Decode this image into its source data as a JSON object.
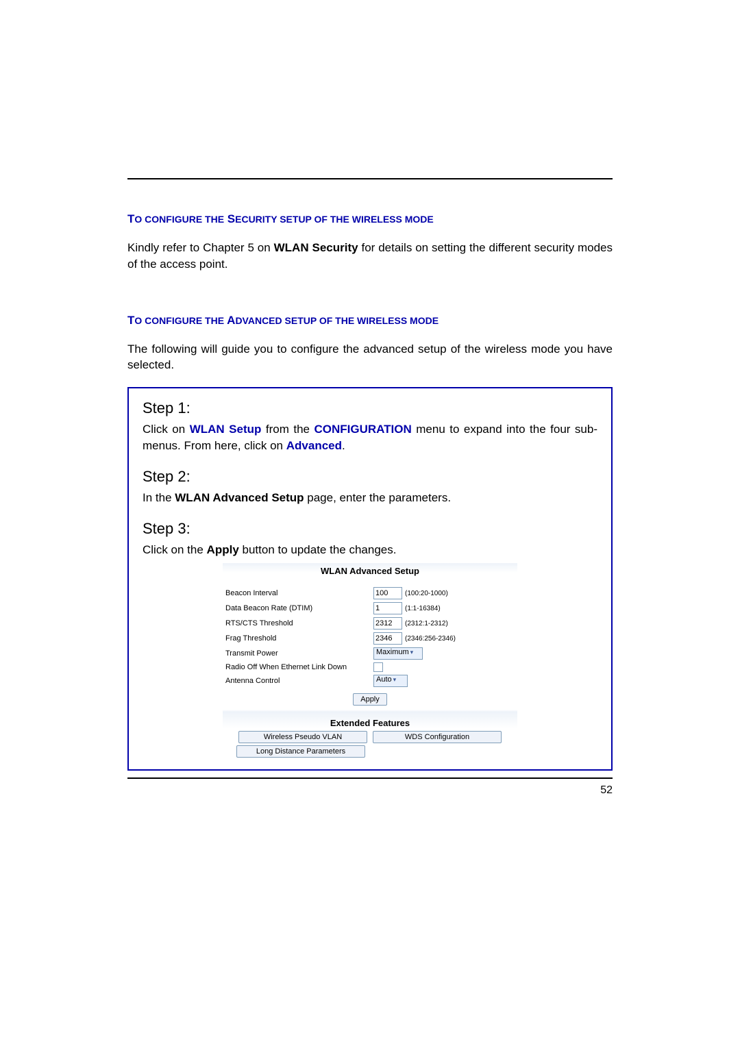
{
  "headings": {
    "security": "To configure the Security setup of the wireless mode",
    "advanced": "To configure the Advanced setup of the wireless mode"
  },
  "paragraphs": {
    "security_intro_a": "Kindly refer to Chapter 5 on ",
    "security_intro_bold": "WLAN Security",
    "security_intro_b": " for details on setting the different security modes of the access point.",
    "advanced_intro": "The following will guide you to configure the advanced setup of the wireless mode you have selected."
  },
  "steps": {
    "s1_title": "Step 1:",
    "s1_a": "Click on ",
    "s1_link1": "WLAN Setup",
    "s1_b": " from the ",
    "s1_link2": "CONFIGURATION",
    "s1_c": " menu to expand into the four sub-menus. From here, click on ",
    "s1_link3": "Advanced",
    "s1_d": ".",
    "s2_title": "Step 2:",
    "s2_a": "In the ",
    "s2_bold": "WLAN Advanced Setup",
    "s2_b": " page, enter the parameters.",
    "s3_title": "Step 3:",
    "s3_a": "Click on the ",
    "s3_bold": "Apply",
    "s3_b": " button to update the changes."
  },
  "form": {
    "title": "WLAN Advanced Setup",
    "rows": {
      "beacon": {
        "label": "Beacon Interval",
        "value": "100",
        "hint": "(100:20-1000)"
      },
      "dtim": {
        "label": "Data Beacon Rate (DTIM)",
        "value": "1",
        "hint": "(1:1-16384)"
      },
      "rts": {
        "label": "RTS/CTS Threshold",
        "value": "2312",
        "hint": "(2312:1-2312)"
      },
      "frag": {
        "label": "Frag Threshold",
        "value": "2346",
        "hint": "(2346:256-2346)"
      },
      "tx": {
        "label": "Transmit Power",
        "value": "Maximum"
      },
      "radio": {
        "label": "Radio Off When Ethernet Link Down"
      },
      "ant": {
        "label": "Antenna Control",
        "value": "Auto"
      }
    },
    "apply": "Apply",
    "ext_title": "Extended Features",
    "ext_buttons": {
      "vlan": "Wireless Pseudo VLAN",
      "wds": "WDS Configuration",
      "long": "Long Distance Parameters"
    }
  },
  "page_number": "52"
}
